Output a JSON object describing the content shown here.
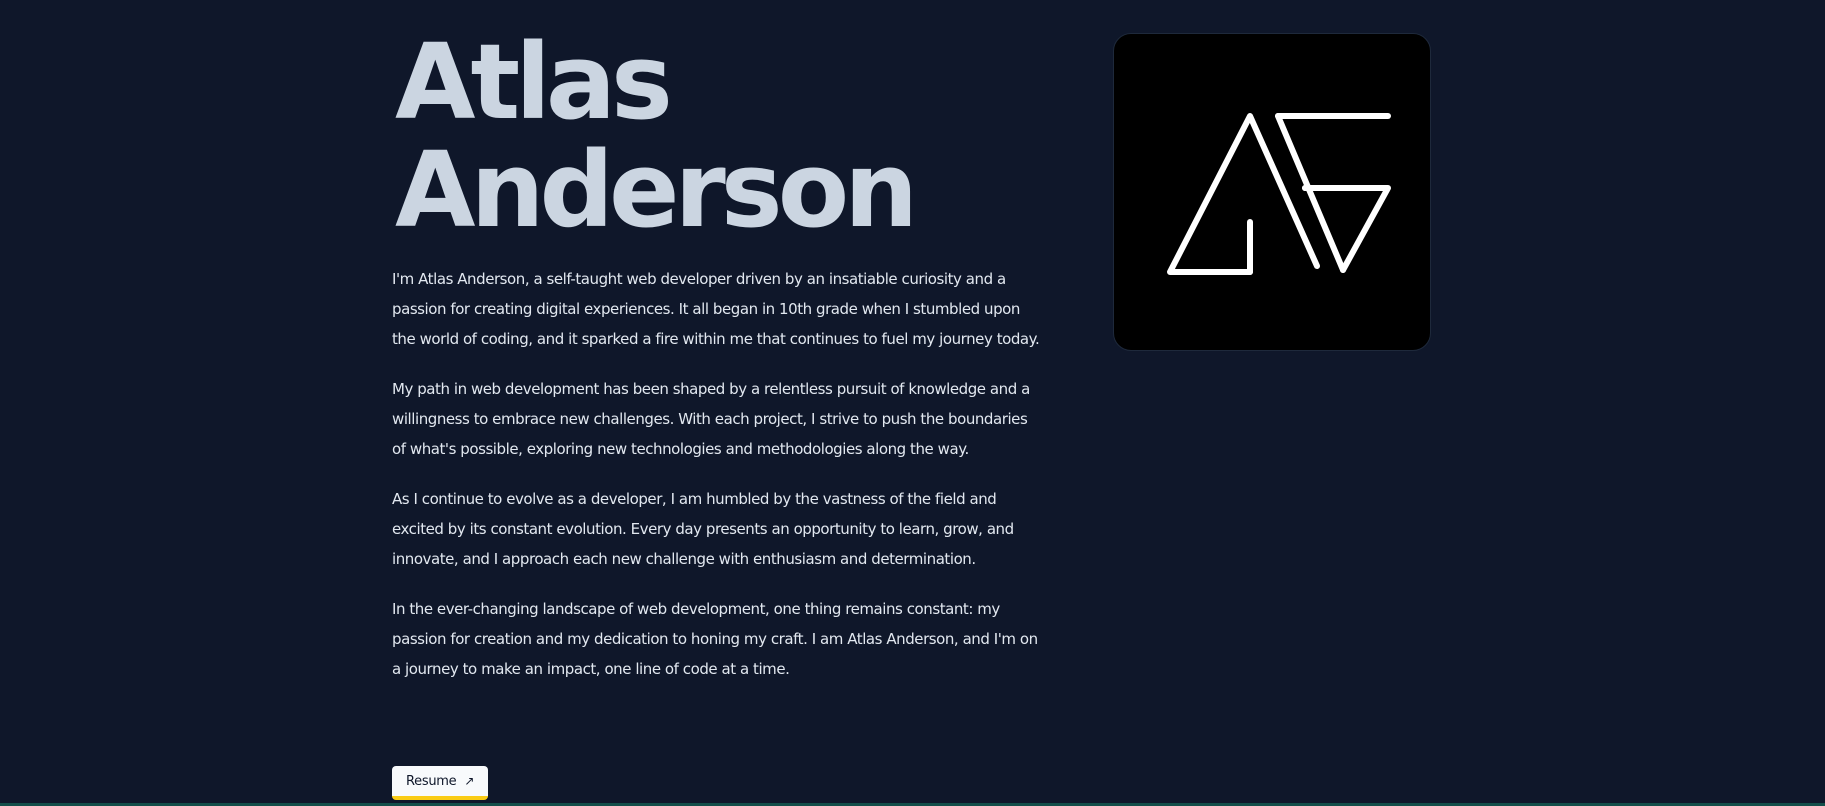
{
  "hero": {
    "name_line1": "Atlas",
    "name_line2": "Anderson"
  },
  "bio": {
    "paragraphs": [
      "I'm Atlas Anderson, a self-taught web developer driven by an insatiable curiosity and a passion for creating digital experiences. It all began in 10th grade when I stumbled upon the world of coding, and it sparked a fire within me that continues to fuel my journey today.",
      "My path in web development has been shaped by a relentless pursuit of knowledge and a willingness to embrace new challenges. With each project, I strive to push the boundaries of what's possible, exploring new technologies and methodologies along the way.",
      "As I continue to evolve as a developer, I am humbled by the vastness of the field and excited by its constant evolution. Every day presents an opportunity to learn, grow, and innovate, and I approach each new challenge with enthusiasm and determination.",
      "In the ever-changing landscape of web development, one thing remains constant: my passion for creation and my dedication to honing my craft. I am Atlas Anderson, and I'm on a journey to make an impact, one line of code at a time."
    ]
  },
  "resume_button": {
    "label": "Resume",
    "icon": "arrow-up-right-icon",
    "arrow_glyph": "↗"
  },
  "logo": {
    "icon": "atlas-anderson-monogram-logo",
    "text": "AA"
  },
  "colors": {
    "background": "#0f172a",
    "name_text": "#cbd5e1",
    "body_text": "#e2e8f0",
    "button_bg": "#f8fafc",
    "button_accent": "#facc15",
    "logo_bg": "#000000",
    "logo_stroke": "#ffffff"
  }
}
